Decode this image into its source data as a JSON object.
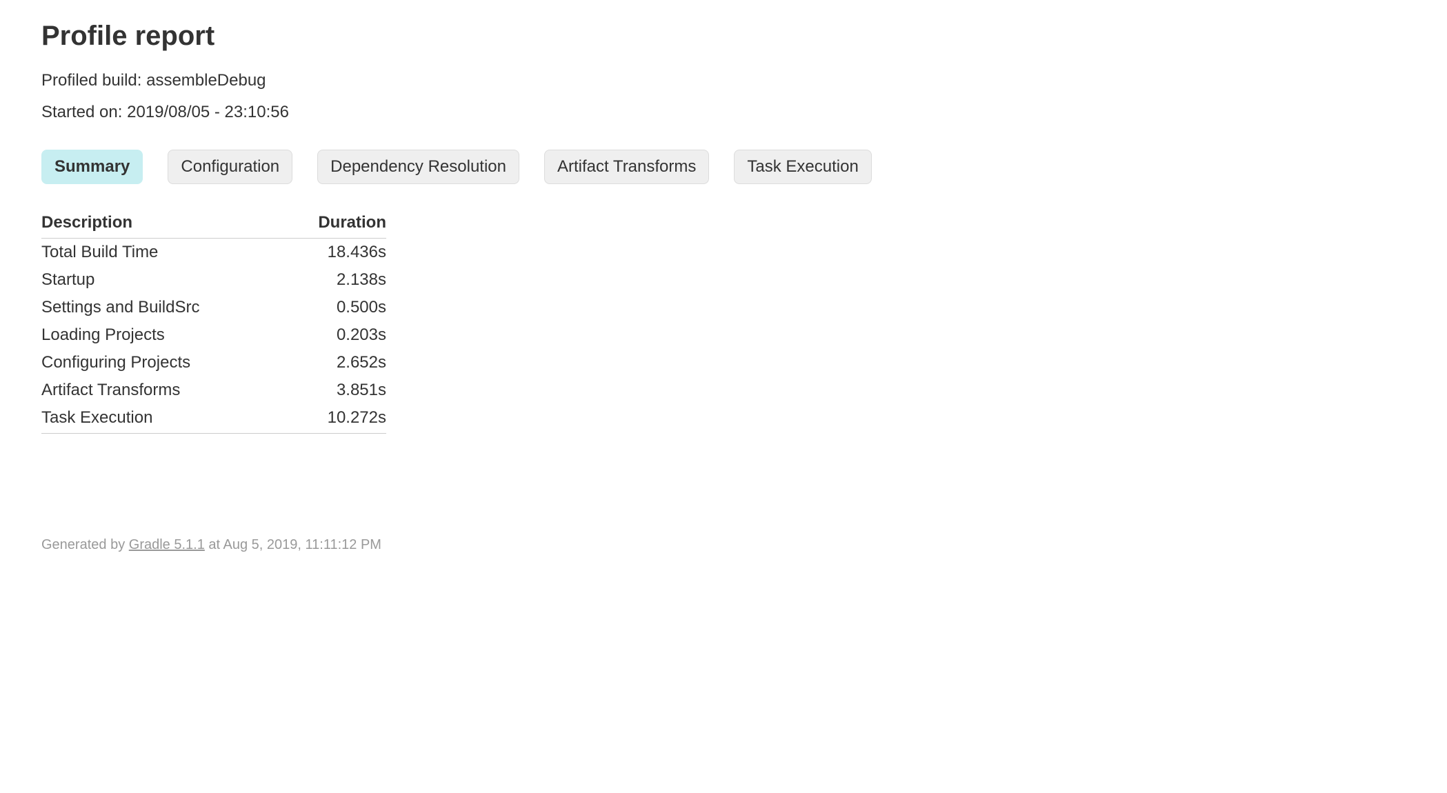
{
  "header": {
    "title": "Profile report",
    "profiled_build_label": "Profiled build:",
    "profiled_build_value": "assembleDebug",
    "started_on_label": "Started on:",
    "started_on_value": "2019/08/05 - 23:10:56"
  },
  "tabs": [
    {
      "label": "Summary",
      "active": true
    },
    {
      "label": "Configuration",
      "active": false
    },
    {
      "label": "Dependency Resolution",
      "active": false
    },
    {
      "label": "Artifact Transforms",
      "active": false
    },
    {
      "label": "Task Execution",
      "active": false
    }
  ],
  "table": {
    "header_description": "Description",
    "header_duration": "Duration",
    "rows": [
      {
        "description": "Total Build Time",
        "duration": "18.436s"
      },
      {
        "description": "Startup",
        "duration": "2.138s"
      },
      {
        "description": "Settings and BuildSrc",
        "duration": "0.500s"
      },
      {
        "description": "Loading Projects",
        "duration": "0.203s"
      },
      {
        "description": "Configuring Projects",
        "duration": "2.652s"
      },
      {
        "description": "Artifact Transforms",
        "duration": "3.851s"
      },
      {
        "description": "Task Execution",
        "duration": "10.272s"
      }
    ]
  },
  "footer": {
    "generated_by": "Generated by",
    "link_text": "Gradle 5.1.1",
    "at_text": "at Aug 5, 2019, 11:11:12 PM"
  }
}
